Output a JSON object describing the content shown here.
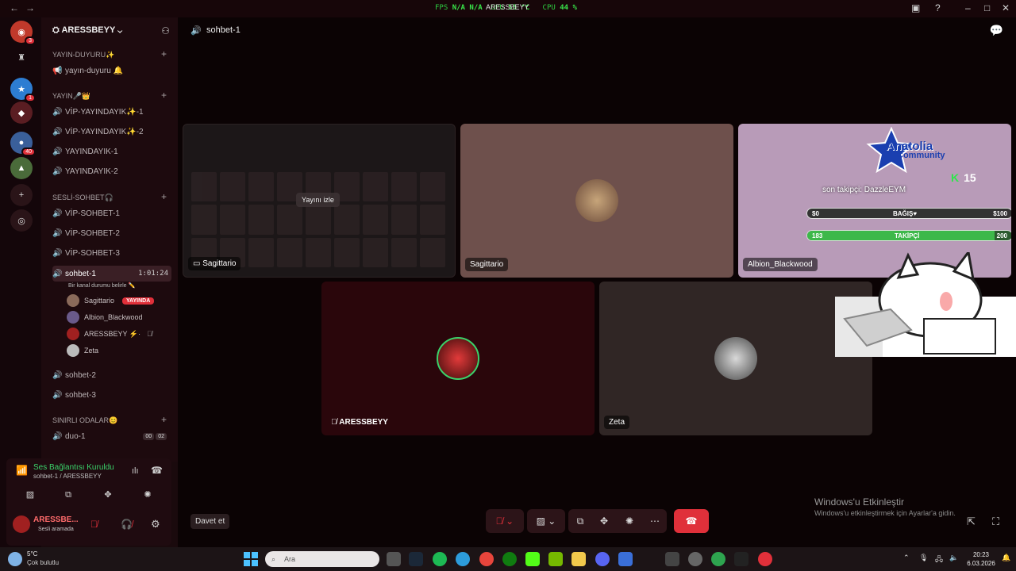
{
  "titlebar": {
    "fps_label": "FPS",
    "fps_value": "N/A",
    "fps_value2": "N/A",
    "gpu_label": "GPU",
    "gpu_value": "55 °C",
    "cpu_label": "CPU",
    "cpu_value": "44 %",
    "overlay_user": "ARESSBEYY"
  },
  "rail": {
    "badges": [
      "3",
      "1",
      "40"
    ]
  },
  "server": {
    "name": "ARESSBEYY"
  },
  "sidebar": {
    "cat_announce": "YAYIN-DUYURU✨",
    "ch_announce": "yayın-duyuru 🔔",
    "cat_stream": "YAYIN🎤👑",
    "ch_vip1": "VİP-YAYINDAYIK✨-1",
    "ch_vip2": "VİP-YAYINDAYIK✨-2",
    "ch_y1": "YAYINDAYIK-1",
    "ch_y2": "YAYINDAYIK-2",
    "cat_voice": "SESLİ-SOHBET🎧",
    "ch_vs1": "VİP-SOHBET-1",
    "ch_vs2": "VİP-SOHBET-2",
    "ch_vs3": "VİP-SOHBET-3",
    "ch_active": "sohbet-1",
    "ch_active_time": "1:01:24",
    "ch_active_sub": "Bir kanal durumu belirle ✏️",
    "members": [
      "Sagittario",
      "Albion_Blackwood",
      "ARESSBEYY ⚡·",
      "Zeta"
    ],
    "live_badge": "YAYINDA",
    "ch_s2": "sohbet-2",
    "ch_s3": "sohbet-3",
    "cat_limited": "SINIRLI ODALAR😊",
    "ch_duo": "duo-1",
    "duo_count_a": "00",
    "duo_count_b": "02"
  },
  "voice_panel": {
    "status": "Ses Bağlantısı Kuruldu",
    "sub": "sohbet-1 / ARESSBEYY",
    "user_name": "ARESSBE...",
    "user_status": "Sesli aramada"
  },
  "main": {
    "channel_title": "sohbet-1",
    "watch_label": "Yayını izle",
    "tiles": [
      {
        "label": "Sagittario"
      },
      {
        "label": "Sagittario"
      },
      {
        "label": "Albion_Blackwood"
      },
      {
        "label": "ARESSBEYY"
      },
      {
        "label": "Zeta"
      }
    ],
    "overlay": {
      "logo_line1": "Anatolia",
      "logo_line2": "Community",
      "follow_text": "son takipçi: DazzleEYM",
      "kick_count": "15",
      "donation_min": "$0",
      "donation_label": "BAĞIŞ♥",
      "donation_max": "$100",
      "follower_current": "183",
      "follower_label": "TAKİPÇİ",
      "follower_goal": "200",
      "follower_progress": 0.915
    },
    "invite_label": "Davet et"
  },
  "activation": {
    "line1": "Windows'u Etkinleştir",
    "line2": "Windows'u etkinleştirmek için Ayarlar'a gidin."
  },
  "taskbar": {
    "weather_temp": "5°C",
    "weather_desc": "Çok bulutlu",
    "search_placeholder": "Ara",
    "time": "20:23",
    "date": "6.03.2026"
  },
  "colors": {
    "accent_red": "#e0303a",
    "voice_green": "#3ad26a",
    "bar_green": "#3db84a"
  }
}
